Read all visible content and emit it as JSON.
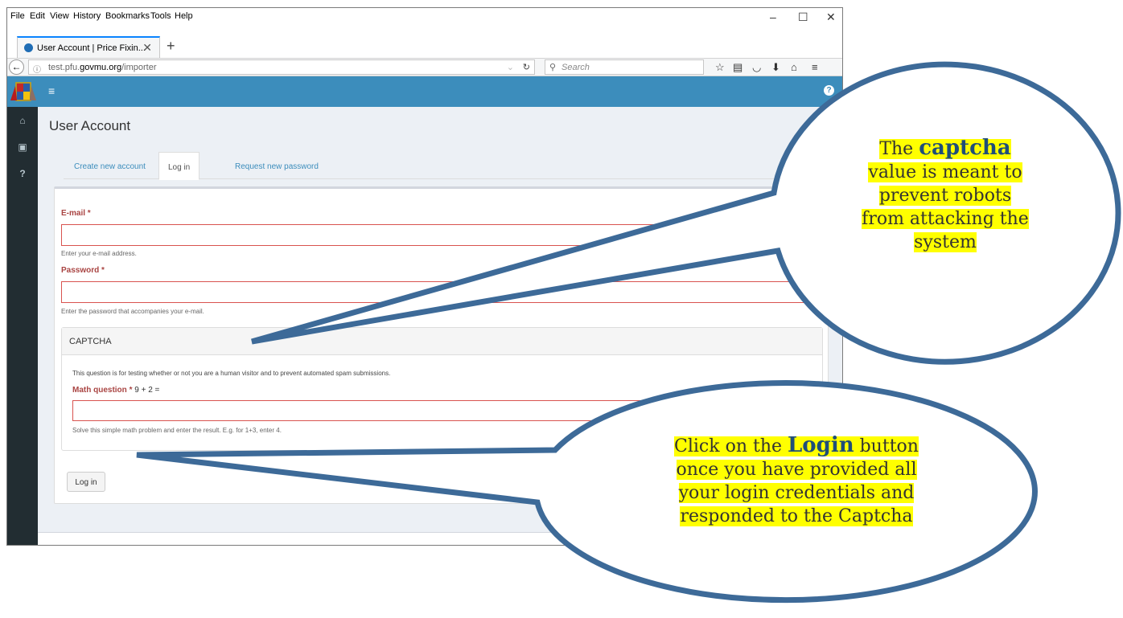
{
  "menubar": {
    "file": "File",
    "edit": "Edit",
    "view": "View",
    "history": "History",
    "bookmarks": "Bookmarks",
    "tools": "Tools",
    "help": "Help"
  },
  "window": {
    "minimize": "–",
    "maximize": "☐",
    "close": "✕"
  },
  "tab": {
    "title": "User Account | Price Fixin...",
    "close": "✕",
    "new": "+"
  },
  "address": {
    "prefix": "test.pfu.",
    "domain": "govmu.org",
    "path": "/importer",
    "search_placeholder": "Search"
  },
  "app": {
    "page_title": "User Account",
    "breadcrumb": "Home",
    "tabs": [
      {
        "label": "Create new account"
      },
      {
        "label": "Log in"
      },
      {
        "label": "Request new password"
      }
    ],
    "email": {
      "label": "E-mail",
      "required": "*",
      "help": "Enter your e-mail address.",
      "value": ""
    },
    "password": {
      "label": "Password",
      "required": "*",
      "help": "Enter the password that accompanies your e-mail.",
      "value": ""
    },
    "captcha": {
      "title": "CAPTCHA",
      "description": "This question is for testing whether or not you are a human visitor and to prevent automated spam submissions.",
      "math_label": "Math question",
      "required": "*",
      "question": "9 + 2 =",
      "help": "Solve this simple math problem and enter the result. E.g. for 1+3, enter 4.",
      "value": ""
    },
    "login_button": "Log in"
  },
  "callouts": {
    "captcha": {
      "line1_pre": "The ",
      "line1_bold": "captcha",
      "line2": "value is meant to",
      "line3": "prevent robots",
      "line4": "from attacking the",
      "line5": "system"
    },
    "login": {
      "line1_pre": "Click on the ",
      "line1_bold": "Login",
      "line1_post": " button",
      "line2": "once you have provided all",
      "line3": "your login credentials and",
      "line4": "responded to the Captcha"
    }
  },
  "colors": {
    "header": "#3c8dbc",
    "sidebar": "#222d32",
    "required": "#a94442",
    "callout_stroke": "#3d6a98",
    "highlight": "#ffff00"
  }
}
